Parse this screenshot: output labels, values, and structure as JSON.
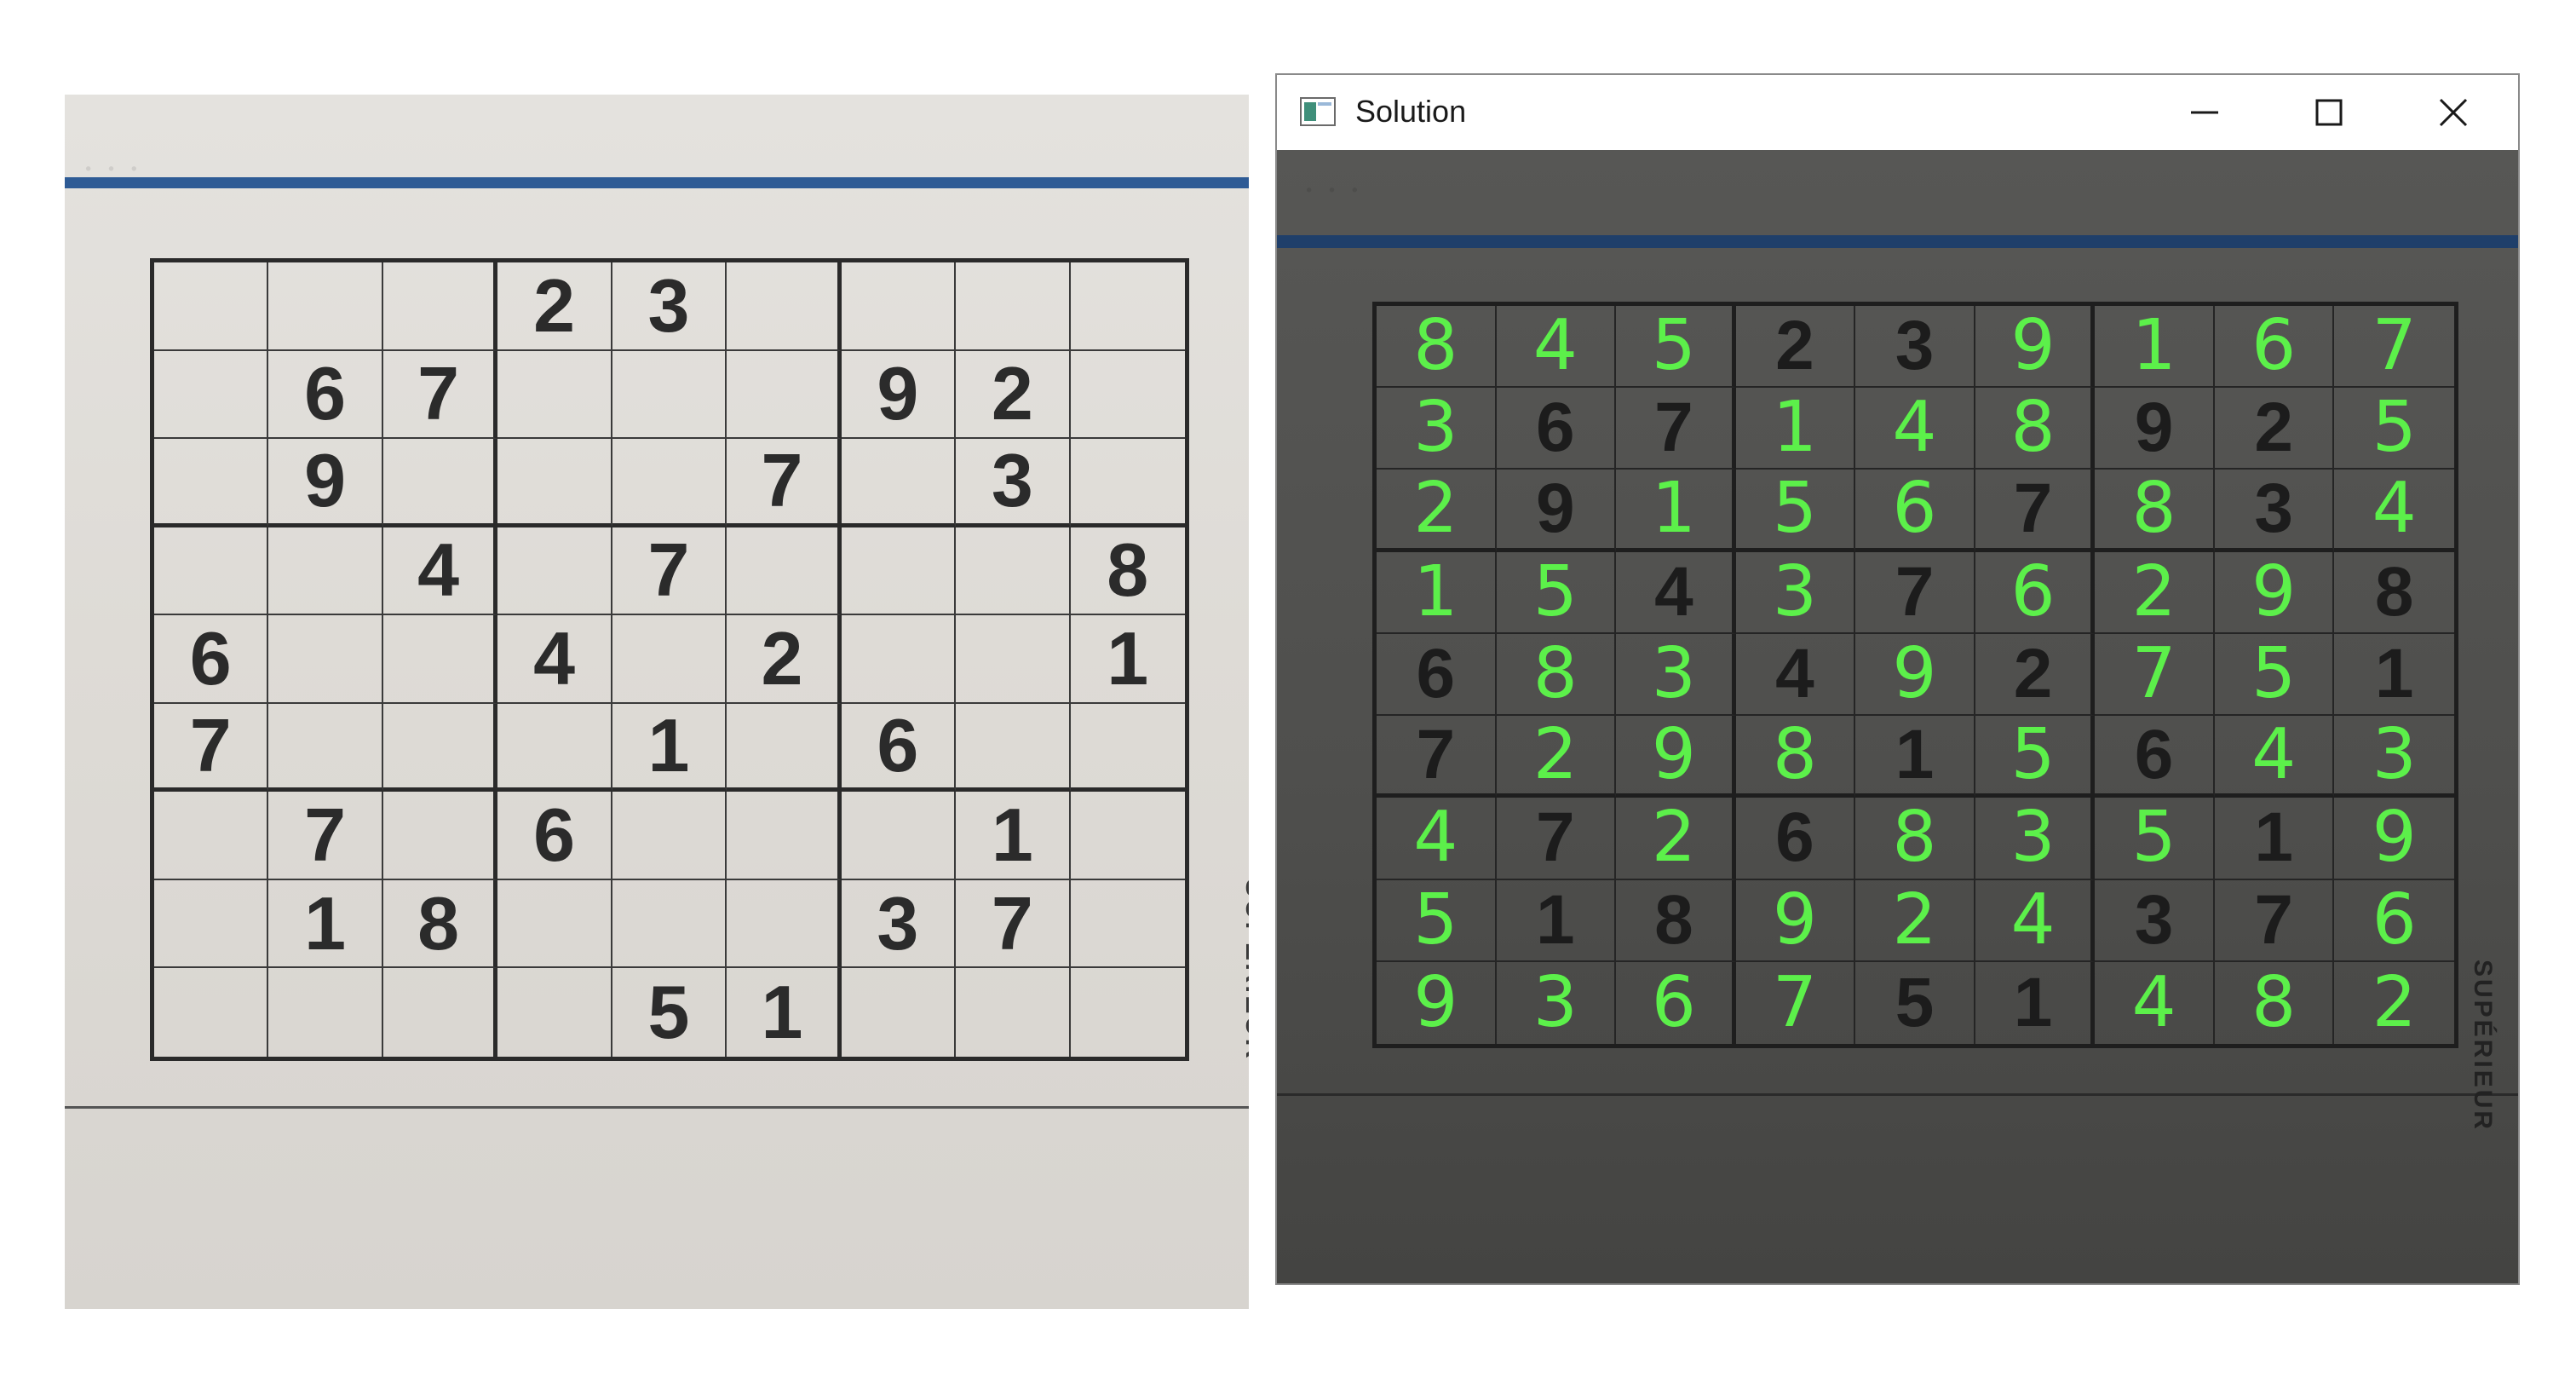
{
  "left_photo": {
    "side_text": "SUPÉRIEUR",
    "puzzle": [
      [
        "",
        "",
        "",
        "2",
        "3",
        "",
        "",
        "",
        ""
      ],
      [
        "",
        "6",
        "7",
        "",
        "",
        "",
        "9",
        "2",
        ""
      ],
      [
        "",
        "9",
        "",
        "",
        "",
        "7",
        "",
        "3",
        ""
      ],
      [
        "",
        "",
        "4",
        "",
        "7",
        "",
        "",
        "",
        "8"
      ],
      [
        "6",
        "",
        "",
        "4",
        "",
        "2",
        "",
        "",
        "1"
      ],
      [
        "7",
        "",
        "",
        "",
        "1",
        "",
        "6",
        "",
        ""
      ],
      [
        "",
        "7",
        "",
        "6",
        "",
        "",
        "",
        "1",
        ""
      ],
      [
        "",
        "1",
        "8",
        "",
        "",
        "",
        "3",
        "7",
        ""
      ],
      [
        "",
        "",
        "",
        "",
        "5",
        "1",
        "",
        "",
        ""
      ]
    ]
  },
  "window": {
    "title": "Solution",
    "icon": "app-window-icon",
    "controls": [
      "minimize-icon",
      "maximize-icon",
      "close-icon"
    ],
    "side_text": "SUPÉRIEUR",
    "solution": [
      [
        "8",
        "4",
        "5",
        "2",
        "3",
        "9",
        "1",
        "6",
        "7"
      ],
      [
        "3",
        "6",
        "7",
        "1",
        "4",
        "8",
        "9",
        "2",
        "5"
      ],
      [
        "2",
        "9",
        "1",
        "5",
        "6",
        "7",
        "8",
        "3",
        "4"
      ],
      [
        "1",
        "5",
        "4",
        "3",
        "7",
        "6",
        "2",
        "9",
        "8"
      ],
      [
        "6",
        "8",
        "3",
        "4",
        "9",
        "2",
        "7",
        "5",
        "1"
      ],
      [
        "7",
        "2",
        "9",
        "8",
        "1",
        "5",
        "6",
        "4",
        "3"
      ],
      [
        "4",
        "7",
        "2",
        "6",
        "8",
        "3",
        "5",
        "1",
        "9"
      ],
      [
        "5",
        "1",
        "8",
        "9",
        "2",
        "4",
        "3",
        "7",
        "6"
      ],
      [
        "9",
        "3",
        "6",
        "7",
        "5",
        "1",
        "4",
        "8",
        "2"
      ]
    ]
  },
  "colors": {
    "solved_digit": "#5cf04a",
    "given_digit": "#1c1c1c",
    "blue_rule": "#2e5b95"
  }
}
